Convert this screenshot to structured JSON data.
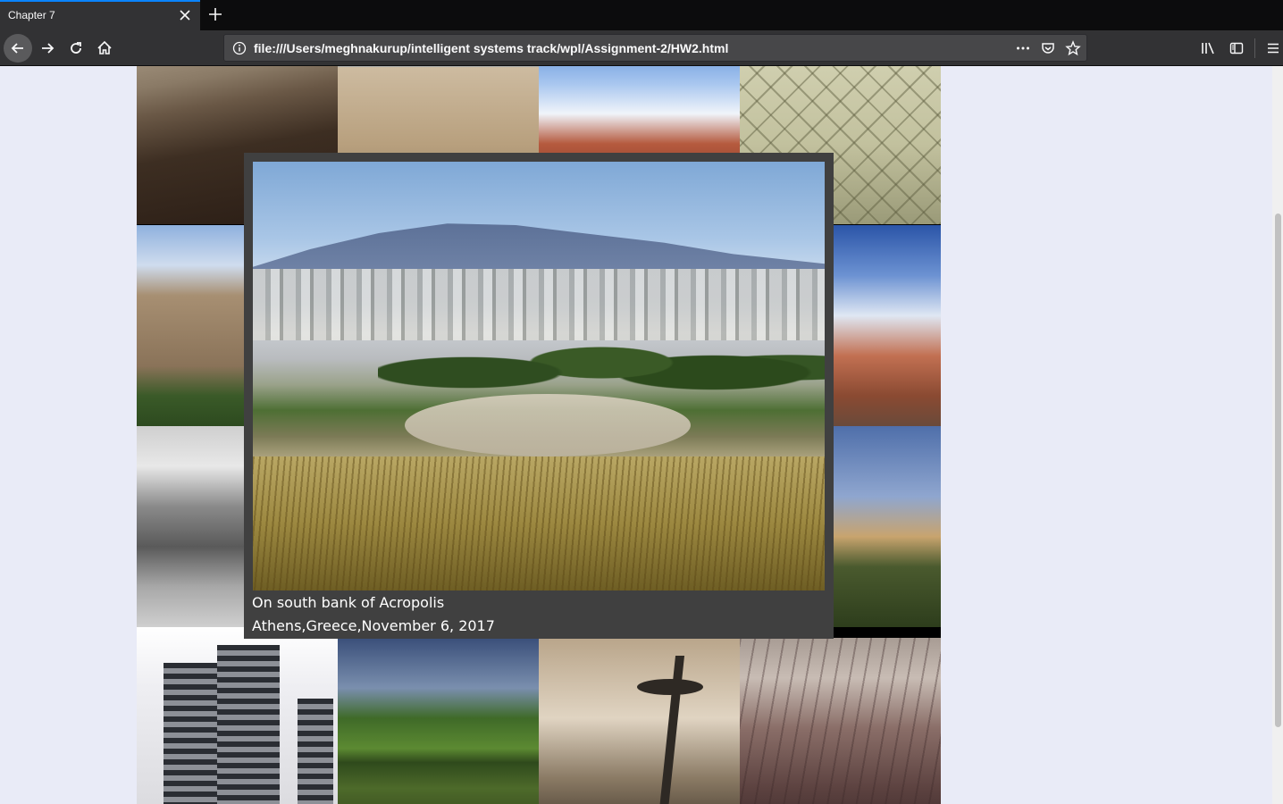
{
  "browser": {
    "tab_title": "Chapter 7",
    "url": "file:///Users/meghnakurup/intelligent systems track/wpl/Assignment-2/HW2.html"
  },
  "icons": {
    "back": "back-arrow-icon",
    "forward": "forward-arrow-icon",
    "reload": "reload-icon",
    "home": "home-icon",
    "info": "info-icon",
    "page_actions": "more-dots-icon",
    "pocket": "pocket-icon",
    "bookmark": "star-icon",
    "library": "library-icon",
    "sidebar": "sidebar-icon",
    "menu": "hamburger-menu-icon"
  },
  "gallery": {
    "thumbnails": [
      "cologne-thumbnail",
      "arch-thumbnail",
      "town-thumbnail",
      "museum-thumbnail",
      "temple-thumbnail",
      "dome-thumbnail",
      "bw-landscape-thumbnail",
      "skyline-thumbnail",
      "office-tower-thumbnail",
      "pond-thumbnail",
      "space-needle-thumbnail",
      "roof-thumbnail"
    ]
  },
  "lightbox": {
    "caption_title": "On south bank of Acropolis",
    "caption_detail": "Athens,Greece,November 6, 2017"
  },
  "colors": {
    "accent": "#0a84ff",
    "chrome": "#323234",
    "page_background": "#e9ebf7",
    "overlay": "#404040"
  }
}
